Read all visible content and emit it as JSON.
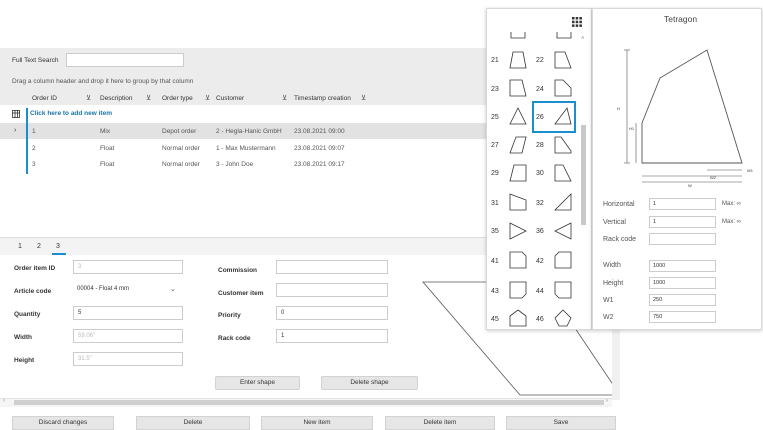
{
  "search": {
    "label": "Full Text Search",
    "value": ""
  },
  "group_hint": "Drag a column header and drop it here to group by that column",
  "grid": {
    "columns": [
      "Order ID",
      "Description",
      "Order type",
      "Customer",
      "Timestamp creation"
    ],
    "filter_glyph": "⊻",
    "add_row": "Click here to add new item",
    "rows": [
      {
        "id": "1",
        "desc": "Mix",
        "type": "Depot order",
        "customer": "2 - Hegla-Hanic GmbH",
        "ts": "23.08.2021 09:00"
      },
      {
        "id": "2",
        "desc": "Float",
        "type": "Normal order",
        "customer": "1 - Max Mustermann",
        "ts": "23.08.2021 09:07"
      },
      {
        "id": "3",
        "desc": "Float",
        "type": "Normal order",
        "customer": "3 - John Doe",
        "ts": "23.08.2021 09:17"
      }
    ]
  },
  "tabs": [
    "1",
    "2",
    "3"
  ],
  "form": {
    "order_item_id": {
      "label": "Order item ID",
      "value": "3"
    },
    "article_code": {
      "label": "Article code",
      "value": "00004 - Float 4 mm"
    },
    "quantity": {
      "label": "Quantity",
      "value": "5"
    },
    "width": {
      "label": "Width",
      "value": "59.06\""
    },
    "height": {
      "label": "Height",
      "value": "31.5\""
    },
    "commission": {
      "label": "Commission",
      "value": ""
    },
    "customer_item": {
      "label": "Customer item",
      "value": ""
    },
    "priority": {
      "label": "Priority",
      "value": "0"
    },
    "rack_code": {
      "label": "Rack code",
      "value": "1"
    },
    "enter_shape": "Enter shape",
    "delete_shape": "Delete shape"
  },
  "bottom_buttons": [
    "Discard changes",
    "Delete",
    "New item",
    "Delete item",
    "Save"
  ],
  "shape_list": {
    "items": [
      "21",
      "22",
      "23",
      "24",
      "25",
      "26",
      "27",
      "28",
      "29",
      "30",
      "31",
      "32",
      "35",
      "36",
      "41",
      "42",
      "43",
      "44",
      "45",
      "46"
    ],
    "selected": "26",
    "accent": "#1a8fcf"
  },
  "tetragon": {
    "title": "Tetragon",
    "dims": {
      "h": "H",
      "h1": "H1",
      "w": "W",
      "w1": "W1",
      "w2": "W2"
    },
    "horizontal": {
      "label": "Horizontal",
      "value": "1",
      "max": "Max: ∞"
    },
    "vertical": {
      "label": "Vertical",
      "value": "1",
      "max": "Max: ∞"
    },
    "rack_code": {
      "label": "Rack code",
      "value": ""
    },
    "width": {
      "label": "Width",
      "value": "1000"
    },
    "height": {
      "label": "Height",
      "value": "1000"
    },
    "w1": {
      "label": "W1",
      "value": "250"
    },
    "w2": {
      "label": "W2",
      "value": "750"
    }
  }
}
